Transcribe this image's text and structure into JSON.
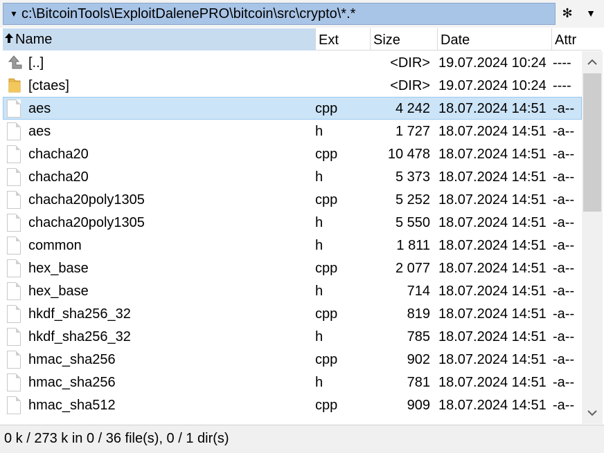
{
  "path": {
    "text": "c:\\BitcoinTools\\ExploitDalenePRO\\bitcoin\\src\\crypto\\*.*",
    "menu_icon": "chevron-down-icon",
    "star_glyph": "✻",
    "dropdown_glyph": "▼"
  },
  "columns": {
    "name": "Name",
    "ext": "Ext",
    "size": "Size",
    "date": "Date",
    "attr": "Attr"
  },
  "rows": [
    {
      "icon": "up-dir-icon",
      "name": "[..]",
      "ext": "",
      "size": "<DIR>",
      "date": "19.07.2024 10:24",
      "attr": "----"
    },
    {
      "icon": "folder-icon",
      "name": "[ctaes]",
      "ext": "",
      "size": "<DIR>",
      "date": "19.07.2024 10:24",
      "attr": "----"
    },
    {
      "icon": "file-icon",
      "name": "aes",
      "ext": "cpp",
      "size": "4 242",
      "date": "18.07.2024 14:51",
      "attr": "-a--",
      "selected": true
    },
    {
      "icon": "file-icon",
      "name": "aes",
      "ext": "h",
      "size": "1 727",
      "date": "18.07.2024 14:51",
      "attr": "-a--"
    },
    {
      "icon": "file-icon",
      "name": "chacha20",
      "ext": "cpp",
      "size": "10 478",
      "date": "18.07.2024 14:51",
      "attr": "-a--"
    },
    {
      "icon": "file-icon",
      "name": "chacha20",
      "ext": "h",
      "size": "5 373",
      "date": "18.07.2024 14:51",
      "attr": "-a--"
    },
    {
      "icon": "file-icon",
      "name": "chacha20poly1305",
      "ext": "cpp",
      "size": "5 252",
      "date": "18.07.2024 14:51",
      "attr": "-a--"
    },
    {
      "icon": "file-icon",
      "name": "chacha20poly1305",
      "ext": "h",
      "size": "5 550",
      "date": "18.07.2024 14:51",
      "attr": "-a--"
    },
    {
      "icon": "file-icon",
      "name": "common",
      "ext": "h",
      "size": "1 811",
      "date": "18.07.2024 14:51",
      "attr": "-a--"
    },
    {
      "icon": "file-icon",
      "name": "hex_base",
      "ext": "cpp",
      "size": "2 077",
      "date": "18.07.2024 14:51",
      "attr": "-a--"
    },
    {
      "icon": "file-icon",
      "name": "hex_base",
      "ext": "h",
      "size": "714",
      "date": "18.07.2024 14:51",
      "attr": "-a--"
    },
    {
      "icon": "file-icon",
      "name": "hkdf_sha256_32",
      "ext": "cpp",
      "size": "819",
      "date": "18.07.2024 14:51",
      "attr": "-a--"
    },
    {
      "icon": "file-icon",
      "name": "hkdf_sha256_32",
      "ext": "h",
      "size": "785",
      "date": "18.07.2024 14:51",
      "attr": "-a--"
    },
    {
      "icon": "file-icon",
      "name": "hmac_sha256",
      "ext": "cpp",
      "size": "902",
      "date": "18.07.2024 14:51",
      "attr": "-a--"
    },
    {
      "icon": "file-icon",
      "name": "hmac_sha256",
      "ext": "h",
      "size": "781",
      "date": "18.07.2024 14:51",
      "attr": "-a--"
    },
    {
      "icon": "file-icon",
      "name": "hmac_sha512",
      "ext": "cpp",
      "size": "909",
      "date": "18.07.2024 14:51",
      "attr": "-a--"
    }
  ],
  "status": "0 k / 273 k in 0 / 36 file(s), 0 / 1 dir(s)",
  "colors": {
    "path_bg": "#a8c4e6",
    "selected_row": "#cce4f7",
    "header_active": "#c8dcf0",
    "folder": "#e8b84a"
  }
}
